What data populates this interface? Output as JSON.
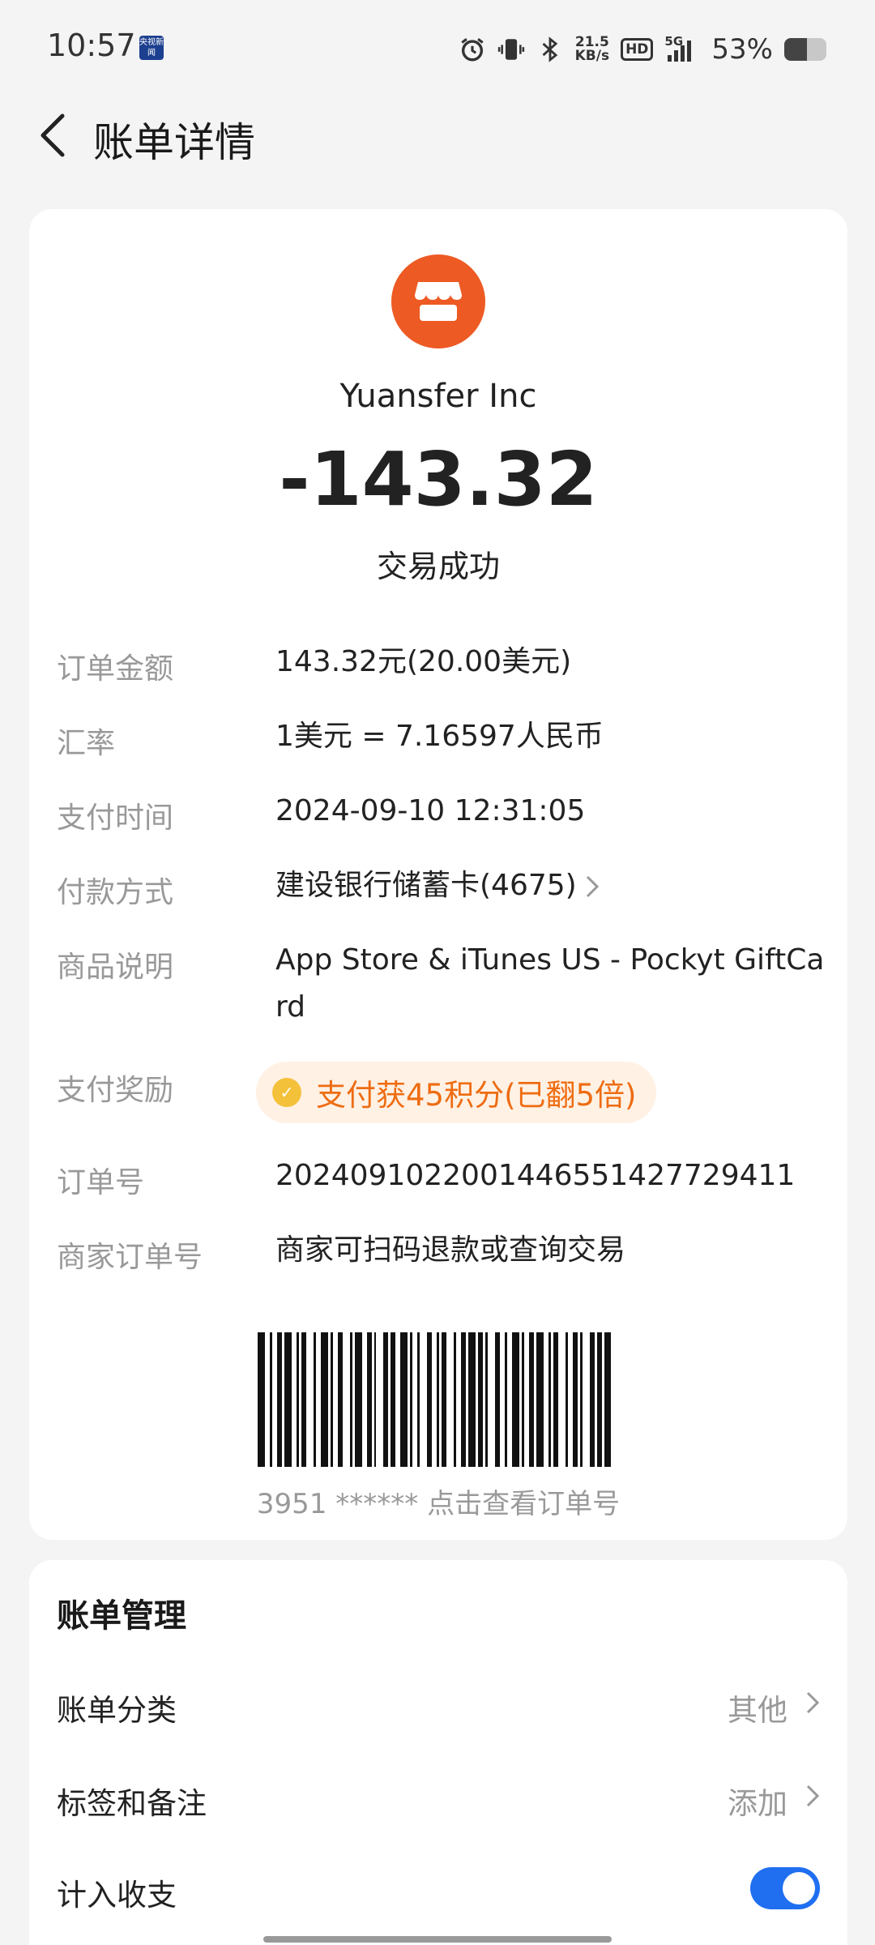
{
  "status_bar": {
    "time": "10:57",
    "news_badge": "央视新闻",
    "net_speed_value": "21.5",
    "net_speed_unit": "KB/s",
    "hd": "HD",
    "signal_type": "5G",
    "battery_percent_text": "53%",
    "battery_level": 0.53
  },
  "header": {
    "title": "账单详情"
  },
  "merchant": {
    "name": "Yuansfer Inc",
    "amount": "-143.32",
    "status": "交易成功",
    "logo_color": "#ed5a23"
  },
  "details": {
    "order_amount_label": "订单金额",
    "order_amount_value": "143.32元(20.00美元)",
    "exchange_rate_label": "汇率",
    "exchange_rate_value": "1美元 = 7.16597人民币",
    "pay_time_label": "支付时间",
    "pay_time_value": "2024-09-10 12:31:05",
    "pay_method_label": "付款方式",
    "pay_method_value": "建设银行储蓄卡(4675)",
    "item_desc_label": "商品说明",
    "item_desc_value": "App Store & iTunes US - Pockyt GiftCard",
    "reward_label": "支付奖励",
    "reward_value": "支付获45积分(已翻5倍)",
    "order_no_label": "订单号",
    "order_no_value": "2024091022001446551427729411",
    "merchant_order_label": "商家订单号",
    "merchant_order_value": "商家可扫码退款或查询交易"
  },
  "barcode": {
    "caption": "3951 ****** 点击查看订单号"
  },
  "management": {
    "title": "账单管理",
    "category_label": "账单分类",
    "category_value": "其他",
    "tags_label": "标签和备注",
    "tags_value": "添加",
    "count_label": "计入收支",
    "count_enabled": true
  },
  "colors": {
    "accent_orange": "#ee6c12",
    "toggle_blue": "#1f6ff0",
    "background": "#f4f4f4"
  }
}
